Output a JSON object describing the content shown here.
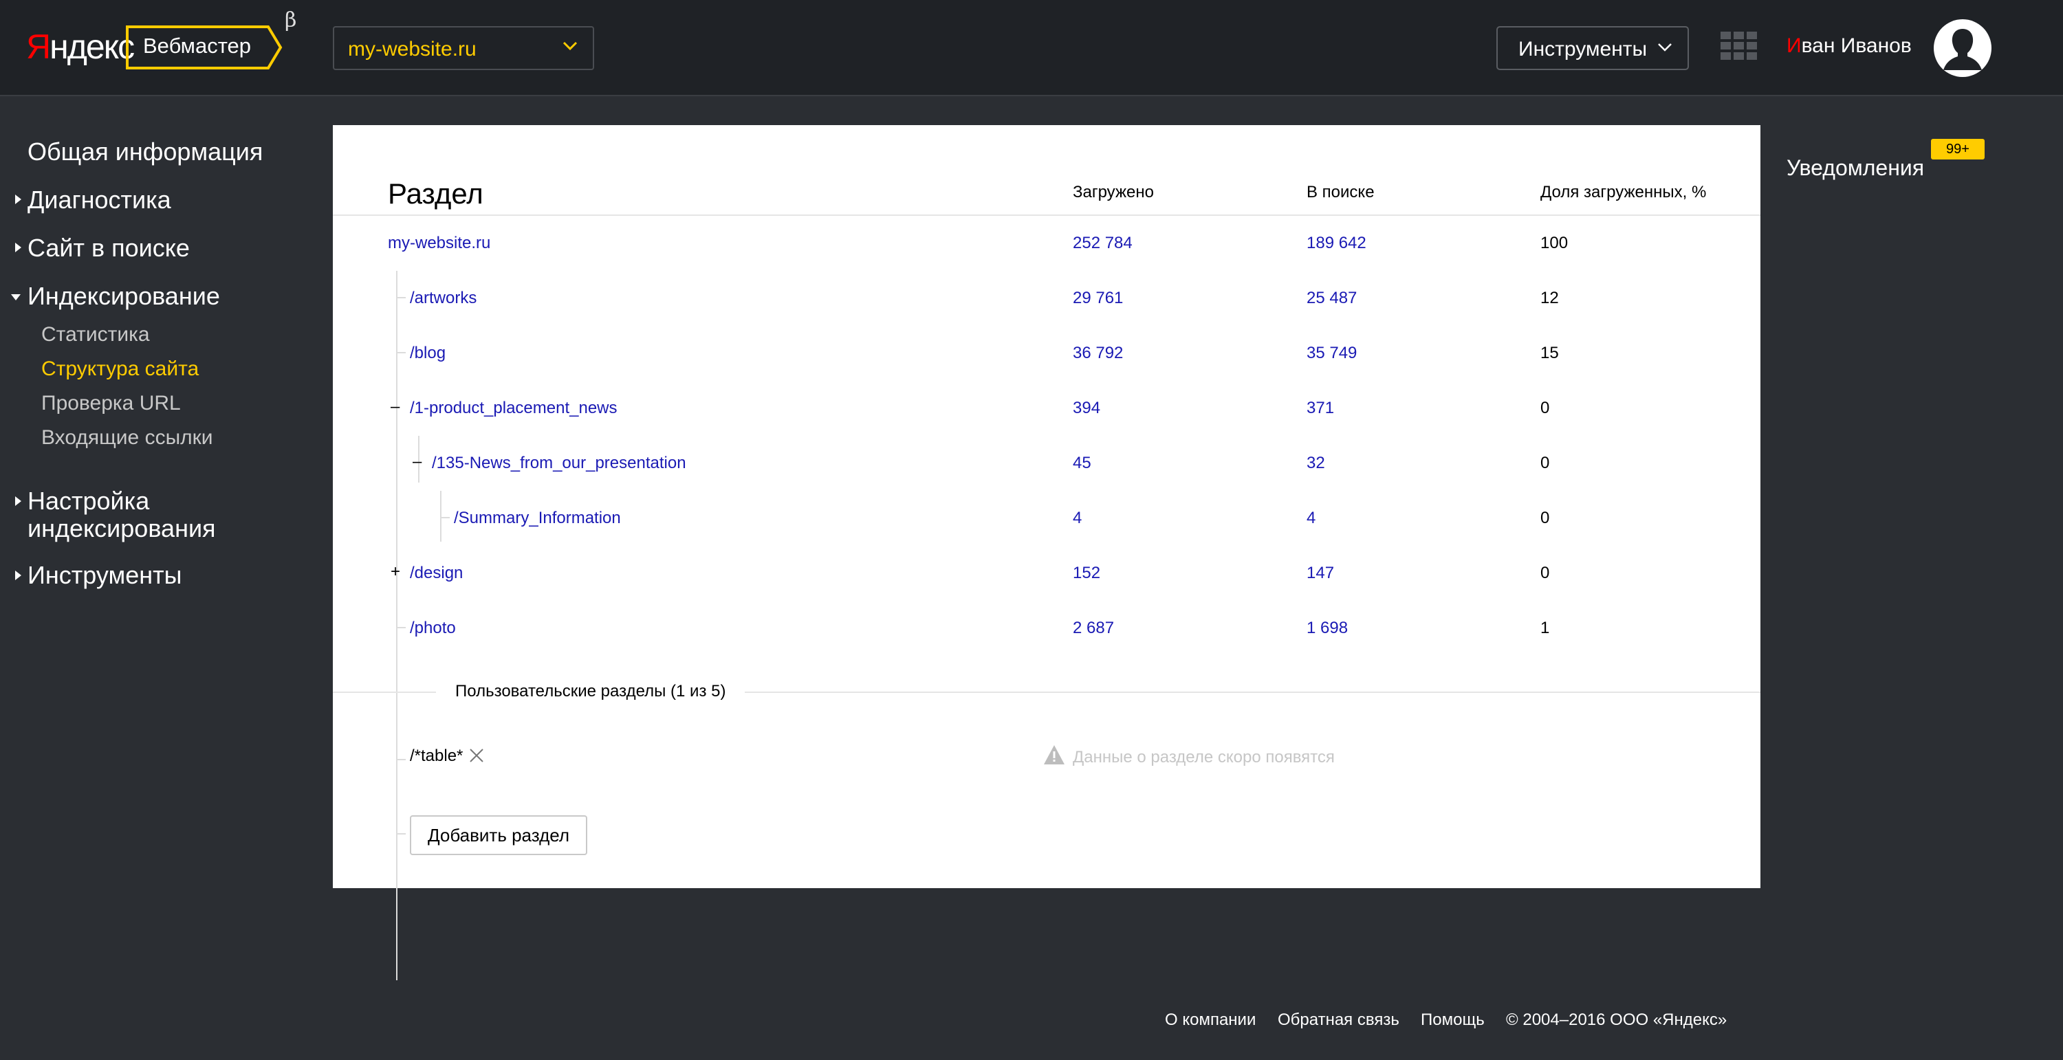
{
  "header": {
    "logo_first_letter": "Я",
    "logo_rest": "ндекс",
    "product": "Вебмастер",
    "beta": "β",
    "site_selector": {
      "value": "my-website.ru",
      "icon": "chevron-down-icon"
    },
    "tools_menu": "Инструменты",
    "apps_icon": "grid-icon",
    "user": {
      "first_letter": "И",
      "rest": "ван Иванов"
    },
    "avatar_icon": "user-avatar-icon"
  },
  "sidebar": {
    "items": [
      {
        "label": "Общая информация",
        "expandable": false
      },
      {
        "label": "Диагностика",
        "expandable": true,
        "expanded": false
      },
      {
        "label": "Сайт в поиске",
        "expandable": true,
        "expanded": false
      },
      {
        "label": "Индексирование",
        "expandable": true,
        "expanded": true,
        "children": [
          {
            "label": "Статистика",
            "active": false
          },
          {
            "label": "Структура сайта",
            "active": true
          },
          {
            "label": "Проверка URL",
            "active": false
          },
          {
            "label": "Входящие ссылки",
            "active": false
          }
        ]
      },
      {
        "label_line1": "Настройка",
        "label_line2": "индексирования",
        "expandable": true,
        "expanded": false
      },
      {
        "label": "Инструменты",
        "expandable": true,
        "expanded": false
      }
    ]
  },
  "table": {
    "title": "Раздел",
    "columns": [
      "Загружено",
      "В поиске",
      "Доля загруженных, %"
    ],
    "rows": [
      {
        "section": "my-website.ru",
        "loaded": "252 784",
        "in_search": "189 642",
        "share": "100",
        "marker": ""
      },
      {
        "section": "/artworks",
        "loaded": "29 761",
        "in_search": "25 487",
        "share": "12",
        "marker": ""
      },
      {
        "section": "/blog",
        "loaded": "36 792",
        "in_search": "35 749",
        "share": "15",
        "marker": ""
      },
      {
        "section": "/1-product_placement_news",
        "loaded": "394",
        "in_search": "371",
        "share": "0",
        "marker": "–"
      },
      {
        "section": "/135-News_from_our_presentation",
        "loaded": "45",
        "in_search": "32",
        "share": "0",
        "marker": "–"
      },
      {
        "section": "/Summary_Information",
        "loaded": "4",
        "in_search": "4",
        "share": "0",
        "marker": ""
      },
      {
        "section": "/design",
        "loaded": "152",
        "in_search": "147",
        "share": "0",
        "marker": "+"
      },
      {
        "section": "/photo",
        "loaded": "2 687",
        "in_search": "1 698",
        "share": "1",
        "marker": ""
      }
    ],
    "custom_sections_label": "Пользовательские разделы (1 из 5)",
    "custom_sections": [
      {
        "pattern": "/*table*",
        "status": "Данные о разделе скоро появятся",
        "status_icon": "warning-icon",
        "remove_icon": "close-icon"
      }
    ],
    "add_button": "Добавить раздел"
  },
  "notifications": {
    "title": "Уведомления",
    "badge": "99+"
  },
  "footer": {
    "links": [
      "О компании",
      "Обратная связь",
      "Помощь"
    ],
    "copyright": "© 2004–2016  ООО «Яндекс»"
  },
  "colors": {
    "background": "#2b2e33",
    "header": "#1f2226",
    "accent_yellow": "#ffcc00",
    "brand_red": "#ff0000",
    "link_blue": "#1a1ab4"
  }
}
